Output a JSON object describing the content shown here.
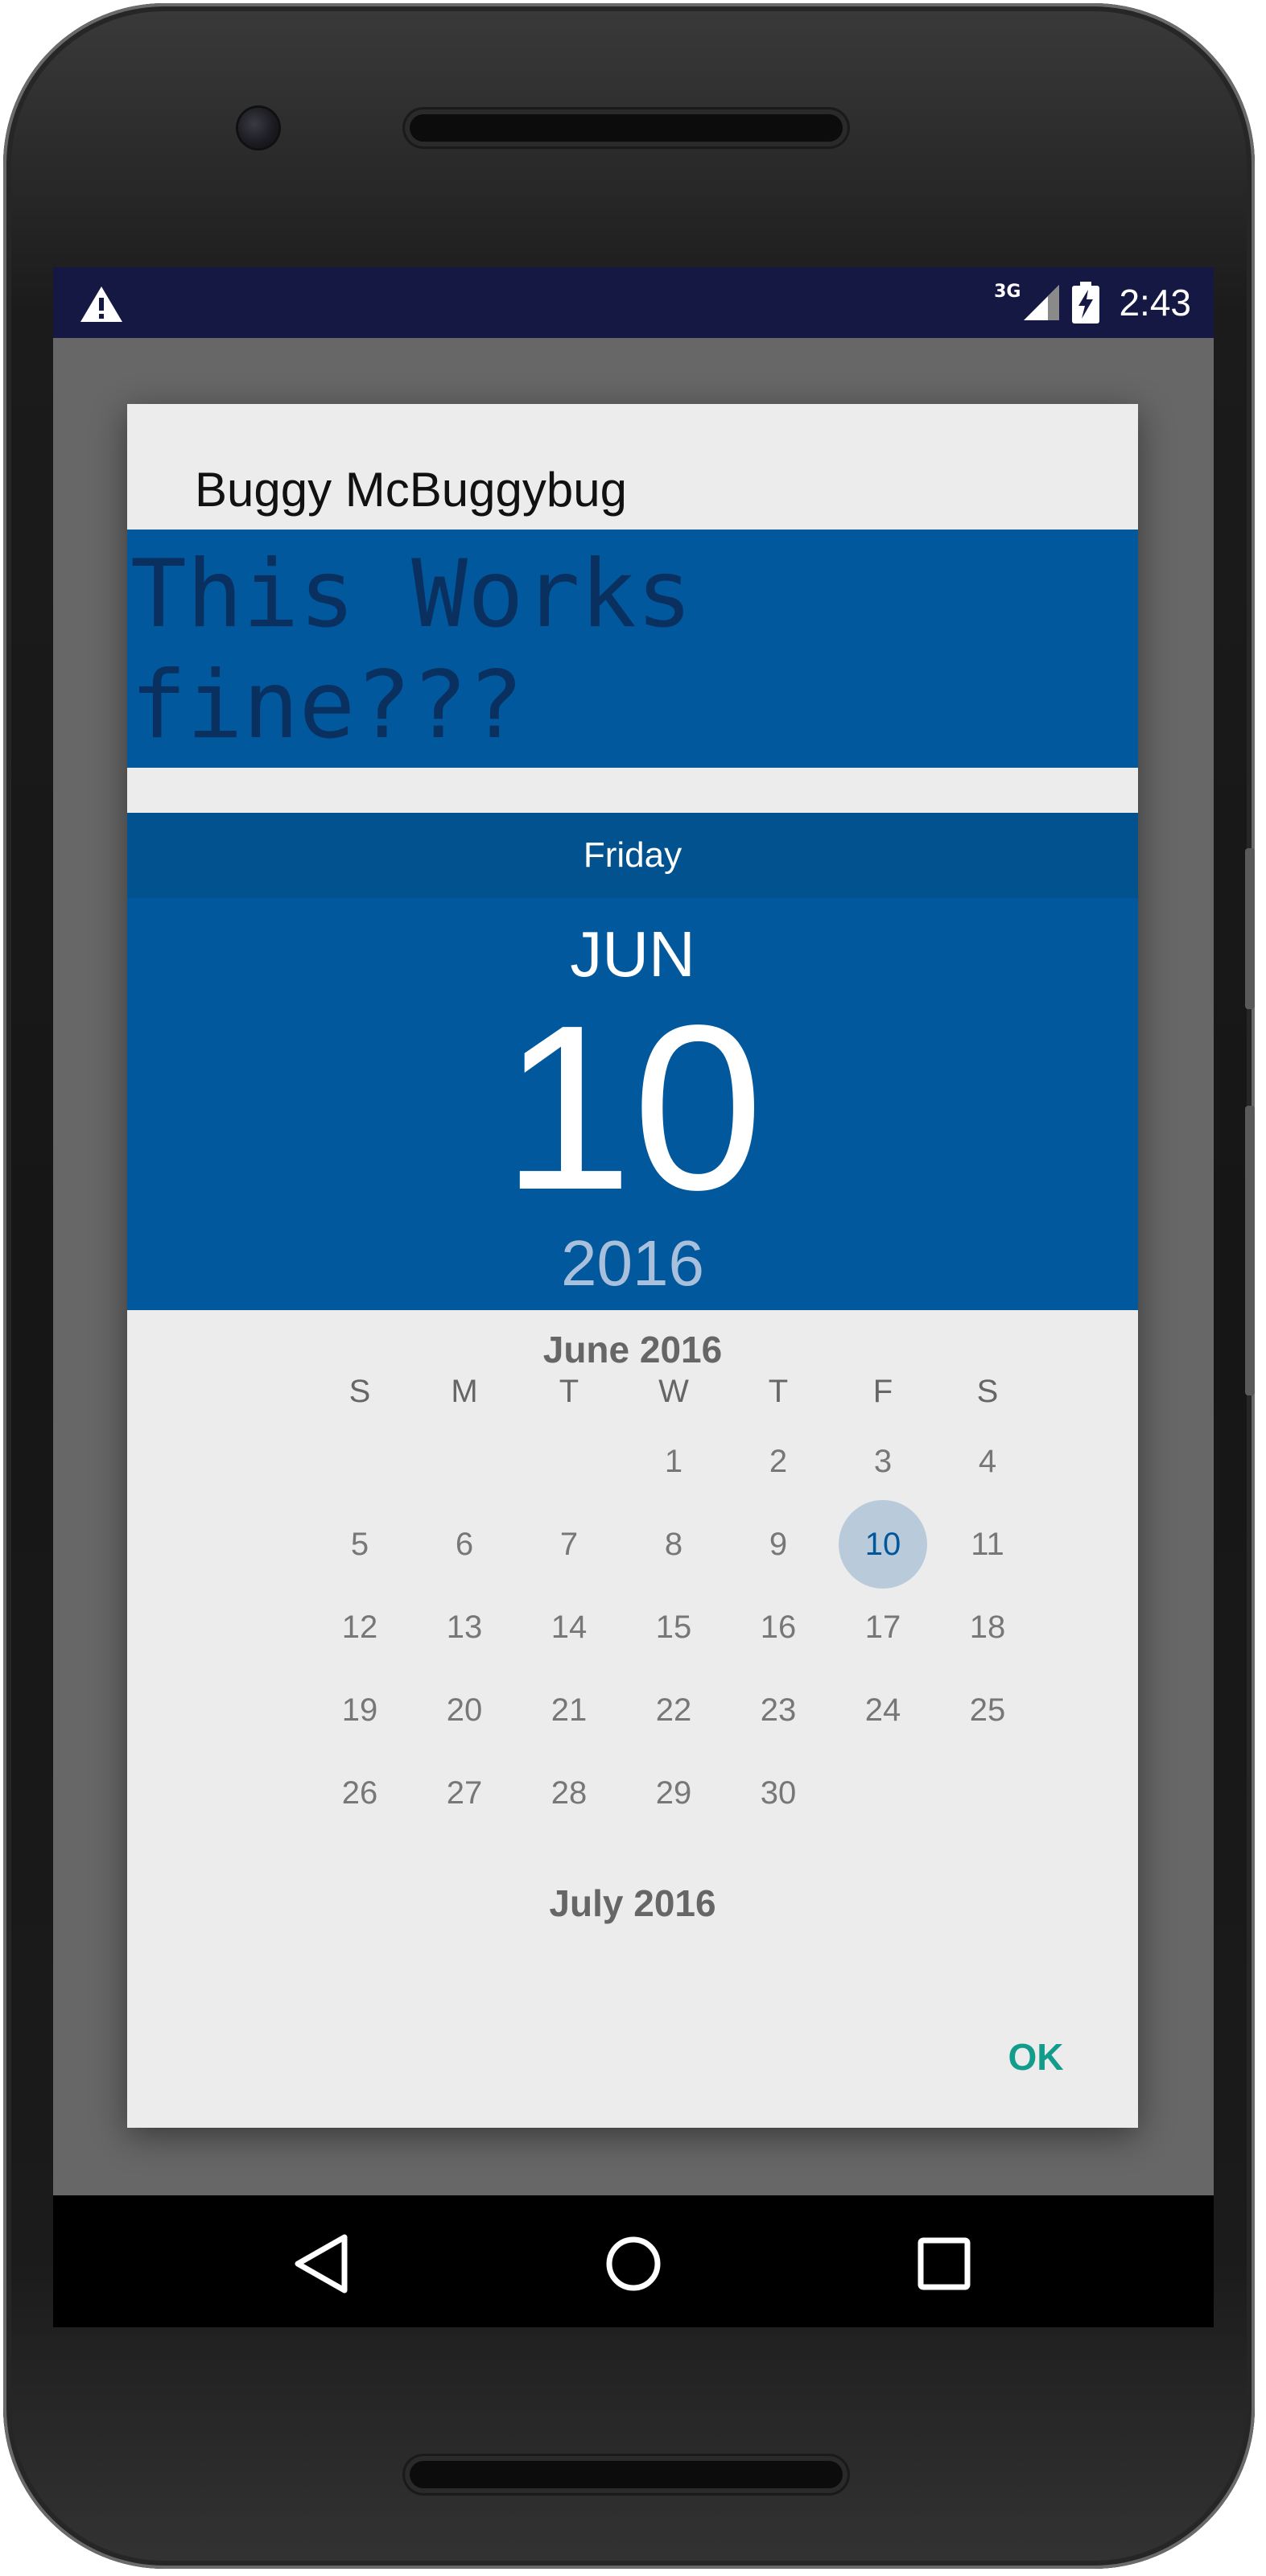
{
  "status_bar": {
    "network_type": "3G",
    "time": "2:43",
    "icons": [
      "warning-icon",
      "signal-icon",
      "battery-charging-icon"
    ]
  },
  "dialog": {
    "title": "Buggy McBuggybug",
    "custom_text": "This Works\nfine???",
    "header": {
      "day_of_week": "Friday",
      "month": "JUN",
      "day": "10",
      "year": "2016"
    },
    "calendar": {
      "month_label": "June 2016",
      "weekdays": [
        "S",
        "M",
        "T",
        "W",
        "T",
        "F",
        "S"
      ],
      "weeks": [
        [
          "",
          "",
          "",
          "1",
          "2",
          "3",
          "4"
        ],
        [
          "5",
          "6",
          "7",
          "8",
          "9",
          "10",
          "11"
        ],
        [
          "12",
          "13",
          "14",
          "15",
          "16",
          "17",
          "18"
        ],
        [
          "19",
          "20",
          "21",
          "22",
          "23",
          "24",
          "25"
        ],
        [
          "26",
          "27",
          "28",
          "29",
          "30",
          "",
          ""
        ]
      ],
      "selected_day": "10",
      "next_month_label": "July 2016"
    },
    "ok_label": "OK"
  },
  "nav_bar": {
    "icons": [
      "back-icon",
      "home-icon",
      "recents-icon"
    ]
  },
  "colors": {
    "accent_blue": "#01589d",
    "status_bar": "#141843",
    "ok_teal": "#129c8c",
    "selected_circle": "#b9cbdb"
  }
}
